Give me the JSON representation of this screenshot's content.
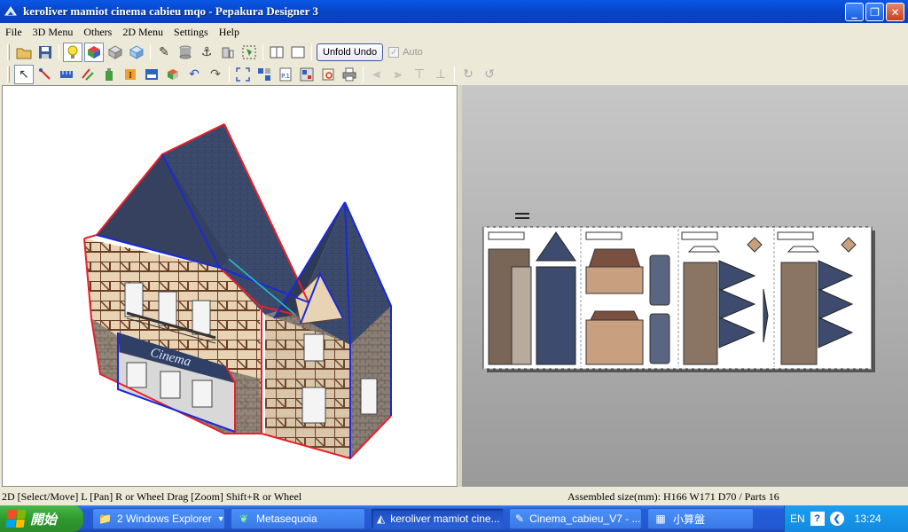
{
  "window": {
    "title": "keroliver mamiot cinema cabieu mqo - Pepakura Designer 3",
    "buttons": {
      "minimize": "_",
      "maximize": "❐",
      "close": "✕"
    }
  },
  "menu": [
    "File",
    "3D Menu",
    "Others",
    "2D Menu",
    "Settings",
    "Help"
  ],
  "toolbar1": {
    "unfold_undo": "Unfold Undo",
    "auto_label": "Auto",
    "auto_checked": true
  },
  "model_sign": "Cinema",
  "statusbar": {
    "left": "2D [Select/Move] L [Pan] R or Wheel Drag [Zoom] Shift+R or Wheel",
    "right": "Assembled size(mm): H166 W171 D70 / Parts 16"
  },
  "taskbar": {
    "start": "開始",
    "tasks": [
      {
        "label": "2 Windows Explorer",
        "icon": "folder-icon",
        "active": false,
        "dropdown": true
      },
      {
        "label": "Metasequoia",
        "icon": "leaf-icon",
        "active": false
      },
      {
        "label": "keroliver mamiot cine...",
        "icon": "pepakura-icon",
        "active": true
      },
      {
        "label": "Cinema_cabieu_V7 - ...",
        "icon": "paint-icon",
        "active": false
      },
      {
        "label": "小算盤",
        "icon": "calculator-icon",
        "active": false
      }
    ],
    "tray": {
      "lang": "EN",
      "help": "?",
      "time": "13:24"
    }
  },
  "colors": {
    "title_blue": "#0a58e6",
    "roof": "#3b4a6b",
    "seam_red": "#e8202a",
    "seam_blue": "#1a2ad8"
  }
}
